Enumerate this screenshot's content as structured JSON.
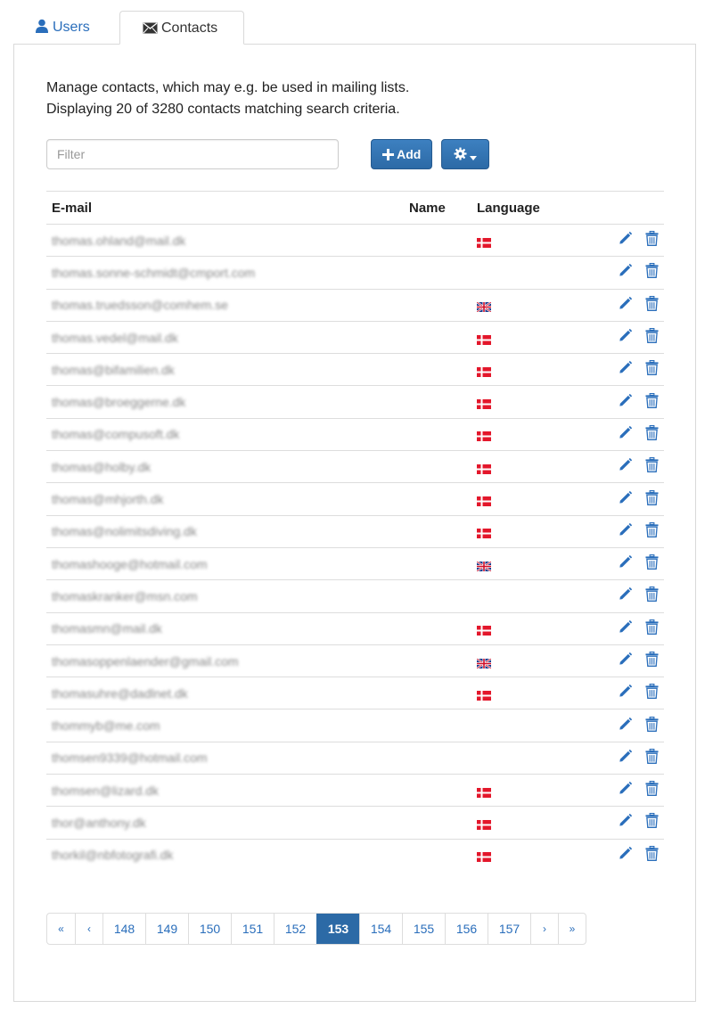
{
  "tabs": {
    "users": "Users",
    "contacts": "Contacts"
  },
  "intro": {
    "line1": "Manage contacts, which may e.g. be used in mailing lists.",
    "line2": "Displaying 20 of 3280 contacts matching search criteria."
  },
  "filter": {
    "placeholder": "Filter",
    "value": ""
  },
  "buttons": {
    "add": "Add",
    "gear_icon": "gear-icon"
  },
  "table": {
    "headers": {
      "email": "E-mail",
      "name": "Name",
      "language": "Language"
    },
    "rows": [
      {
        "email": "thomas.ohland@mail.dk",
        "name": "",
        "language": "dk"
      },
      {
        "email": "thomas.sonne-schmidt@cmport.com",
        "name": "",
        "language": ""
      },
      {
        "email": "thomas.truedsson@comhem.se",
        "name": "",
        "language": "gb"
      },
      {
        "email": "thomas.vedel@mail.dk",
        "name": "",
        "language": "dk"
      },
      {
        "email": "thomas@bifamilien.dk",
        "name": "",
        "language": "dk"
      },
      {
        "email": "thomas@broeggerne.dk",
        "name": "",
        "language": "dk"
      },
      {
        "email": "thomas@compusoft.dk",
        "name": "",
        "language": "dk"
      },
      {
        "email": "thomas@holby.dk",
        "name": "",
        "language": "dk"
      },
      {
        "email": "thomas@mhjorth.dk",
        "name": "",
        "language": "dk"
      },
      {
        "email": "thomas@nolimitsdiving.dk",
        "name": "",
        "language": "dk"
      },
      {
        "email": "thomashooge@hotmail.com",
        "name": "",
        "language": "gb"
      },
      {
        "email": "thomaskranker@msn.com",
        "name": "",
        "language": ""
      },
      {
        "email": "thomasmn@mail.dk",
        "name": "",
        "language": "dk"
      },
      {
        "email": "thomasoppenlaender@gmail.com",
        "name": "",
        "language": "gb"
      },
      {
        "email": "thomasuhre@dadlnet.dk",
        "name": "",
        "language": "dk"
      },
      {
        "email": "thommyb@me.com",
        "name": "",
        "language": ""
      },
      {
        "email": "thomsen9339@hotmail.com",
        "name": "",
        "language": ""
      },
      {
        "email": "thomsen@lizard.dk",
        "name": "",
        "language": "dk"
      },
      {
        "email": "thor@anthony.dk",
        "name": "",
        "language": "dk"
      },
      {
        "email": "thorkil@nbfotografi.dk",
        "name": "",
        "language": "dk"
      }
    ]
  },
  "pagination": {
    "first": "«",
    "prev": "‹",
    "pages": [
      "148",
      "149",
      "150",
      "151",
      "152",
      "153",
      "154",
      "155",
      "156",
      "157"
    ],
    "active": "153",
    "next": "›",
    "last": "»"
  },
  "colors": {
    "accent": "#2c6aa6",
    "link": "#2a6ebb",
    "border": "#dddddd"
  }
}
